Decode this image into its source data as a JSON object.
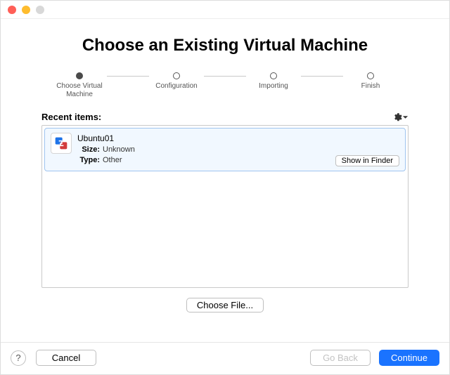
{
  "title": "Choose an Existing Virtual Machine",
  "steps": [
    {
      "label": "Choose Virtual Machine",
      "active": true
    },
    {
      "label": "Configuration",
      "active": false
    },
    {
      "label": "Importing",
      "active": false
    },
    {
      "label": "Finish",
      "active": false
    }
  ],
  "recent": {
    "heading": "Recent items:",
    "items": [
      {
        "name": "Ubuntu01",
        "size_label": "Size:",
        "size_value": "Unknown",
        "type_label": "Type:",
        "type_value": "Other",
        "show_in_finder": "Show in Finder"
      }
    ]
  },
  "buttons": {
    "choose_file": "Choose File...",
    "cancel": "Cancel",
    "go_back": "Go Back",
    "continue": "Continue",
    "help": "?"
  }
}
